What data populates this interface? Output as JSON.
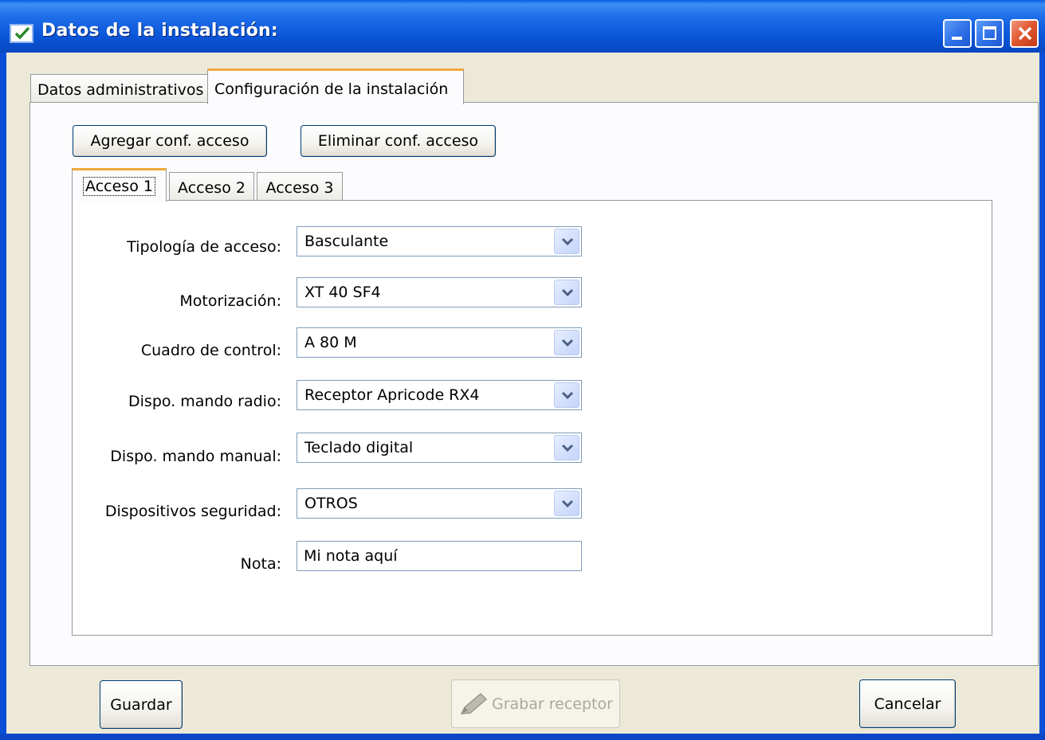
{
  "window": {
    "title": "Datos de la instalación:",
    "icons": {
      "app": "checkbox-app-icon",
      "minimize": "minimize-icon",
      "maximize": "maximize-icon",
      "close": "close-icon"
    }
  },
  "outer_tabs": [
    {
      "label": "Datos administrativos",
      "selected": false
    },
    {
      "label": "Configuración de la instalación",
      "selected": true
    }
  ],
  "toolbar": {
    "add_label": "Agregar conf. acceso",
    "remove_label": "Eliminar conf. acceso"
  },
  "inner_tabs": [
    {
      "label": "Acceso 1",
      "selected": true
    },
    {
      "label": "Acceso 2",
      "selected": false
    },
    {
      "label": "Acceso 3",
      "selected": false
    }
  ],
  "form": {
    "tipologia": {
      "label": "Tipología de acceso:",
      "value": "Basculante"
    },
    "motorizacion": {
      "label": "Motorización:",
      "value": "XT 40 SF4"
    },
    "cuadro": {
      "label": "Cuadro de control:",
      "value": "A 80 M"
    },
    "radio": {
      "label": "Dispo. mando radio:",
      "value": "Receptor Apricode RX4"
    },
    "manual": {
      "label": "Dispo. mando manual:",
      "value": "Teclado digital"
    },
    "seguridad": {
      "label": "Dispositivos seguridad:",
      "value": "OTROS"
    },
    "nota": {
      "label": "Nota:",
      "value": "Mi nota aquí"
    }
  },
  "footer": {
    "save_label": "Guardar",
    "burn_label": "Grabar receptor",
    "burn_icon": "pencil-icon",
    "cancel_label": "Cancelar"
  },
  "colors": {
    "titlebar": "#0A55D8",
    "window_bg": "#ECE9D8",
    "tab_accent": "#F0A83A",
    "close_button": "#E0552E"
  }
}
